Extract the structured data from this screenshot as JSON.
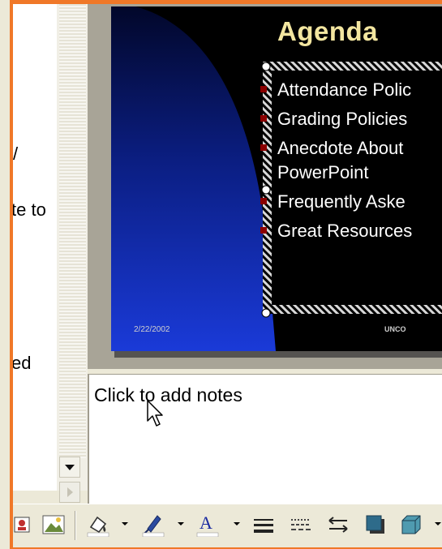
{
  "outline": {
    "fragments": [
      "/",
      "te to",
      "ed"
    ]
  },
  "slide": {
    "title": "Agenda",
    "bullets": [
      "Attendance Polic",
      "Grading Policies",
      "Anecdote About",
      "PowerPoint",
      "Frequently Aske",
      "Great Resources"
    ],
    "date": "2/22/2002",
    "footer": "UNCO"
  },
  "notes": {
    "placeholder": "Click to add notes"
  },
  "toolbar": {
    "icons": [
      "picture-icon",
      "insert-image-icon",
      "fill-color-icon",
      "line-color-icon",
      "font-color-icon",
      "line-style-icon",
      "dash-style-icon",
      "arrow-style-icon",
      "shadow-icon",
      "3d-icon"
    ]
  },
  "colors": {
    "window_border": "#f07828",
    "slide_background": "#000000",
    "slide_gradient_top": "#02072a",
    "slide_gradient_bottom": "#1a3ad8",
    "title_color": "#f3e6a0",
    "bullet_color": "#8b0000"
  }
}
